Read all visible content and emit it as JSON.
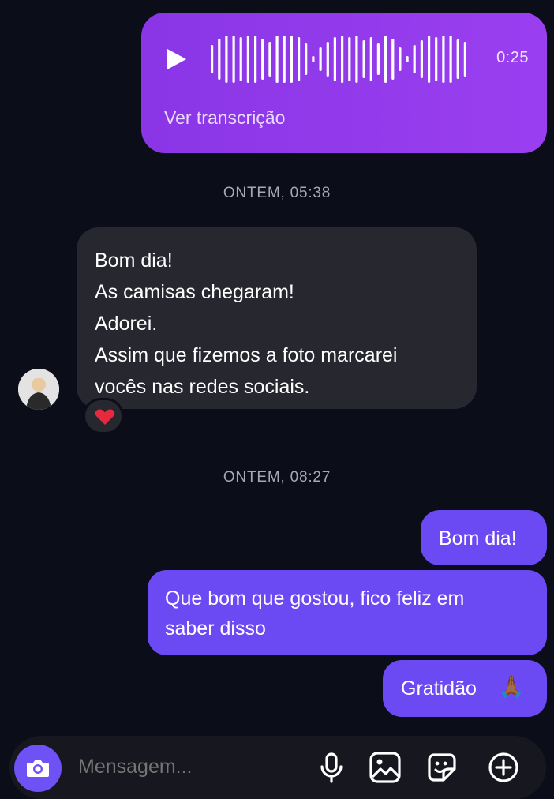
{
  "voice_message": {
    "duration": "0:25",
    "transcript_link": "Ver transcrição"
  },
  "timestamps": [
    "ONTEM, 05:38",
    "ONTEM, 08:27"
  ],
  "received_message": {
    "lines": [
      "Bom dia!",
      "As camisas chegaram!",
      "Adorei.",
      "Assim que fizemos a foto marcarei",
      "vocês nas redes sociais."
    ],
    "reaction": "❤️"
  },
  "sent_messages": [
    {
      "lines": [
        "Bom dia!"
      ]
    },
    {
      "lines": [
        "Que bom que gostou, fico feliz em",
        "saber disso"
      ]
    },
    {
      "lines": [
        "Gratidão"
      ],
      "emoji": "🙏🏾"
    }
  ],
  "composer": {
    "placeholder": "Mensagem...",
    "icons": [
      "camera-icon",
      "microphone-icon",
      "image-icon",
      "sticker-icon",
      "plus-circle-icon"
    ]
  },
  "colors": {
    "background": "#0b0d18",
    "voice_bubble": "#9038ec",
    "received_bubble": "#26272f",
    "sent_bubble": "#6b49f3",
    "timestamp": "#a6a9b3"
  }
}
